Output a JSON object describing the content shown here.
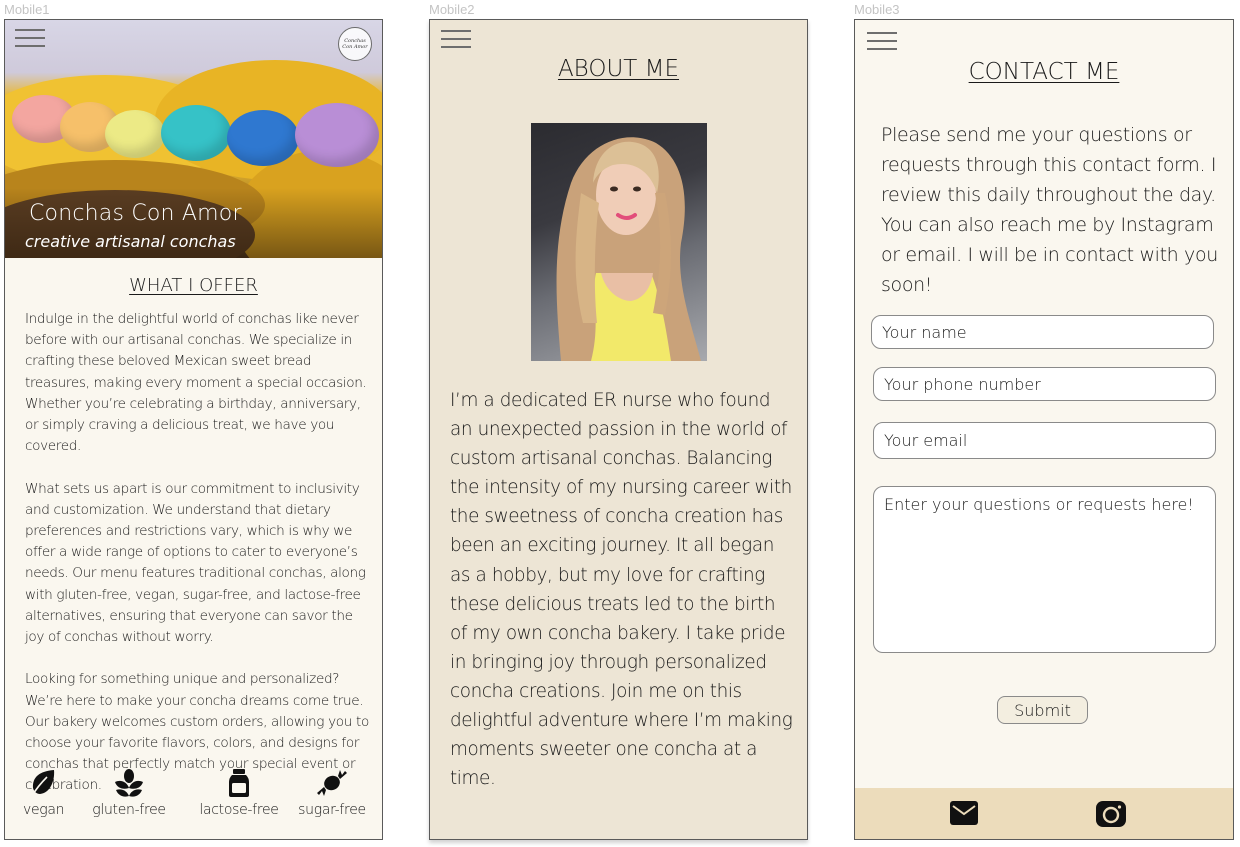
{
  "frames": {
    "mobile1_label": "Mobile1",
    "mobile2_label": "Mobile2",
    "mobile3_label": "Mobile3"
  },
  "mobile1": {
    "logo_text": "Conchas Con Amor",
    "hero_title": "Conchas Con Amor",
    "hero_subtitle": "creative artisanal conchas",
    "section_title": "WHAT I OFFER",
    "paragraphs": [
      "Indulge in the delightful world of conchas like never before with our artisanal conchas. We specialize in crafting these beloved Mexican sweet bread treasures, making every moment a special occasion. Whether you’re celebrating a birthday, anniversary, or simply craving a delicious treat, we have you covered.",
      "What sets us apart is our commitment to inclusivity and customization. We understand that dietary preferences and restrictions vary, which is why we offer a wide range of options to cater to everyone’s needs. Our menu features traditional conchas, along with gluten-free, vegan, sugar-free, and lactose-free alternatives, ensuring that everyone can savor the joy of conchas without worry.",
      "Looking for something unique and personalized? We’re here to make your concha dreams come true. Our bakery welcomes custom orders, allowing you to choose your favorite flavors, colors, and designs for conchas that perfectly match your special event or celebration."
    ],
    "diet_options": [
      {
        "label": "vegan",
        "icon": "leaf-icon"
      },
      {
        "label": "gluten-free",
        "icon": "wheat-icon"
      },
      {
        "label": "lactose-free",
        "icon": "milk-jar-icon"
      },
      {
        "label": "sugar-free",
        "icon": "candy-icon"
      }
    ]
  },
  "mobile2": {
    "section_title": "ABOUT ME",
    "bio": "I’m a dedicated ER nurse who found an unexpected passion in the world of custom artisanal conchas. Balancing the intensity of my nursing career with the sweetness of concha creation has been an exciting journey. It all began as a hobby, but my love for crafting these delicious treats led to the birth of my own concha bakery. I take pride in bringing joy through personalized concha creations. Join me on this delightful adventure where I’m making moments sweeter one concha at a time."
  },
  "mobile3": {
    "section_title": "CONTACT ME",
    "intro": "Please send me your questions or requests through this contact form. I review this daily throughout the day. You can also reach me by Instagram or email.  I will be in contact with you soon!",
    "name_placeholder": "Your name",
    "phone_placeholder": "Your phone number",
    "email_placeholder": "Your email",
    "message_placeholder": "Enter your questions or requests here!",
    "submit_label": "Submit",
    "footer_icons": [
      "mail-icon",
      "instagram-icon"
    ]
  },
  "colors": {
    "cream": "#faf7ef",
    "beige": "#ede5d5",
    "footer_tan": "#ecdcbb",
    "text": "#1a1a1a"
  }
}
